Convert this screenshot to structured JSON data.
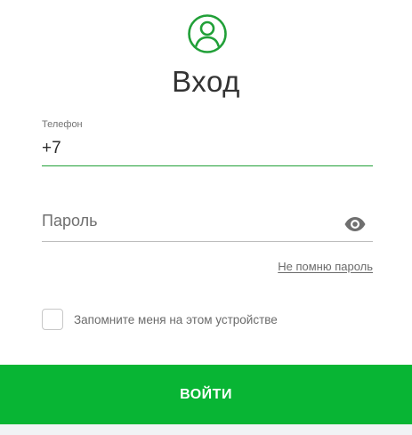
{
  "header": {
    "icon": "user-circle-icon",
    "title": "Вход"
  },
  "phone": {
    "label": "Телефон",
    "value": "+7"
  },
  "password": {
    "placeholder": "Пароль",
    "toggle_icon": "eye-icon"
  },
  "forgot_link": "Не помню пароль",
  "remember": {
    "checked": false,
    "label": "Запомните меня на этом устройстве"
  },
  "submit_label": "ВОЙТИ",
  "colors": {
    "accent": "#21a038",
    "button": "#08b534",
    "text_primary": "#333333",
    "text_secondary": "#6b6b6b"
  }
}
